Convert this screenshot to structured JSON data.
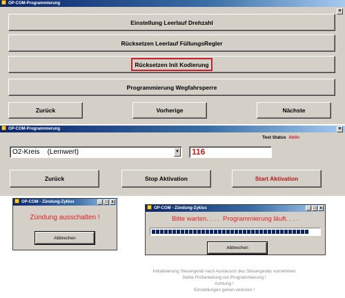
{
  "window1": {
    "title": "OP-COM-Programmierung",
    "buttons": [
      "Einstellung Leerlauf Drehzahl",
      "Rücksetzen Leerlauf FüllungsRegler",
      "Rücksetzen Init Kodierung",
      "Programmierung Wegfahrsperre"
    ],
    "nav": {
      "back": "Zurück",
      "prev": "Vorherige",
      "next": "Nächste"
    }
  },
  "window2": {
    "title": "OP-COM-Programmierung",
    "test_status_label": "Test Status",
    "test_status_value": "Aktiv",
    "test_status_color": "#c8202a",
    "select_value": "O2-Kreis    (Lernwert)",
    "value": "116",
    "buttons": {
      "back": "Zurück",
      "stop": "Stop Aktivation",
      "start": "Start Aktivation"
    }
  },
  "dialog1": {
    "title": "OP-COM - Zündung-Zyklus",
    "message": "Zündung ausschalten !",
    "button": "Abbrechen"
  },
  "dialog2": {
    "title": "OP-COM - Zündung-Zyklus",
    "message": "Bitte warten. . . .  Programmierung läuft. . . .",
    "button": "Abbrechen",
    "progress": 0.96
  },
  "caption": {
    "line1": "Initialisierung Steuergerät nach Austausch des Steuergeräts vornehmen",
    "line2": "Siehe Prüfanleitung vor Programmierung !",
    "line3": "Achtung !",
    "line4": "Einstellungen gehen verloren !"
  },
  "title_icons": [
    "app-icon",
    "minimize-icon",
    "maximize-icon",
    "close-icon"
  ],
  "colors": {
    "accent_red": "#c8202a",
    "titlebar": "#0a246a",
    "window_bg": "#d4d0c8"
  }
}
